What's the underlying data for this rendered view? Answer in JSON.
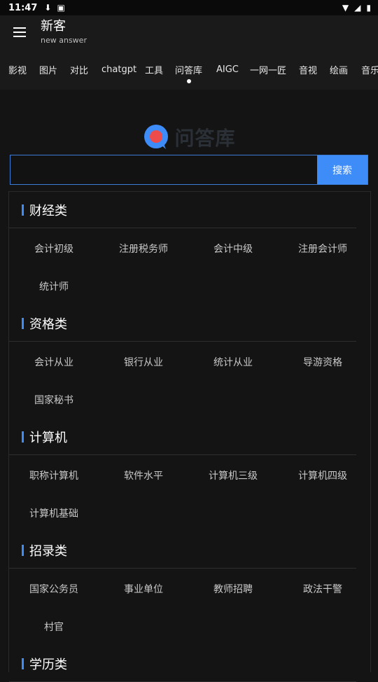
{
  "statusbar": {
    "time": "11:47"
  },
  "appbar": {
    "title": "新客",
    "subtitle": "new answer"
  },
  "tabs": [
    {
      "label": "影视"
    },
    {
      "label": "图片"
    },
    {
      "label": "对比"
    },
    {
      "label": "chatgpt"
    },
    {
      "label": "工具"
    },
    {
      "label": "问答库"
    },
    {
      "label": "AIGC"
    },
    {
      "label": "一网一匠"
    },
    {
      "label": "音视"
    },
    {
      "label": "绘画"
    },
    {
      "label": "音乐"
    }
  ],
  "active_tab": "问答库",
  "logo": {
    "text": "问答库"
  },
  "search": {
    "value": "",
    "button_label": "搜索"
  },
  "colors": {
    "accent": "#3e8cf7",
    "background": "#141414"
  },
  "sections": [
    {
      "title": "财经类",
      "items": [
        "会计初级",
        "注册税务师",
        "会计中级",
        "注册会计师",
        "统计师"
      ]
    },
    {
      "title": "资格类",
      "items": [
        "会计从业",
        "银行从业",
        "统计从业",
        "导游资格",
        "国家秘书"
      ]
    },
    {
      "title": "计算机",
      "items": [
        "职称计算机",
        "软件水平",
        "计算机三级",
        "计算机四级",
        "计算机基础"
      ]
    },
    {
      "title": "招录类",
      "items": [
        "国家公务员",
        "事业单位",
        "教师招聘",
        "政法干警",
        "村官"
      ]
    },
    {
      "title": "学历类",
      "items": []
    }
  ]
}
